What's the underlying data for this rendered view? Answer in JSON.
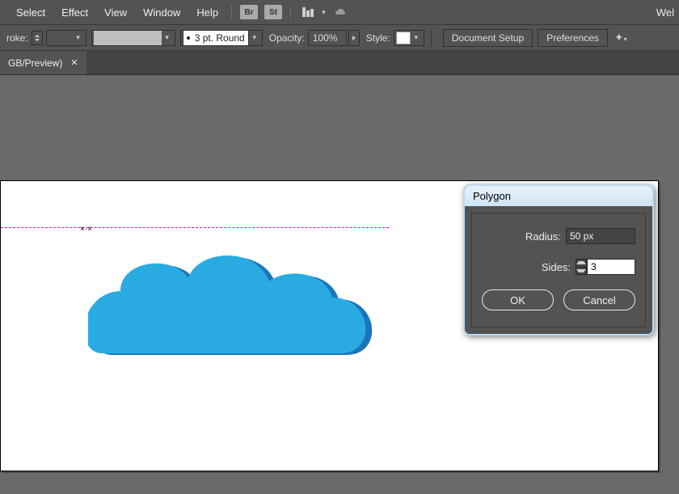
{
  "menu": {
    "items": [
      "Select",
      "Effect",
      "View",
      "Window",
      "Help"
    ],
    "app_icons": [
      "Br",
      "St"
    ],
    "right": "Wel"
  },
  "controlbar": {
    "stroke_label": "roke:",
    "pt_label": "3 pt. Round",
    "opacity_label": "Opacity:",
    "opacity_value": "100%",
    "style_label": "Style:",
    "doc_setup": "Document Setup",
    "preferences": "Preferences"
  },
  "tab": {
    "title": "GB/Preview)"
  },
  "dialog": {
    "title": "Polygon",
    "radius_label": "Radius:",
    "radius_value": "50 px",
    "sides_label": "Sides:",
    "sides_value": "3",
    "ok": "OK",
    "cancel": "Cancel"
  }
}
